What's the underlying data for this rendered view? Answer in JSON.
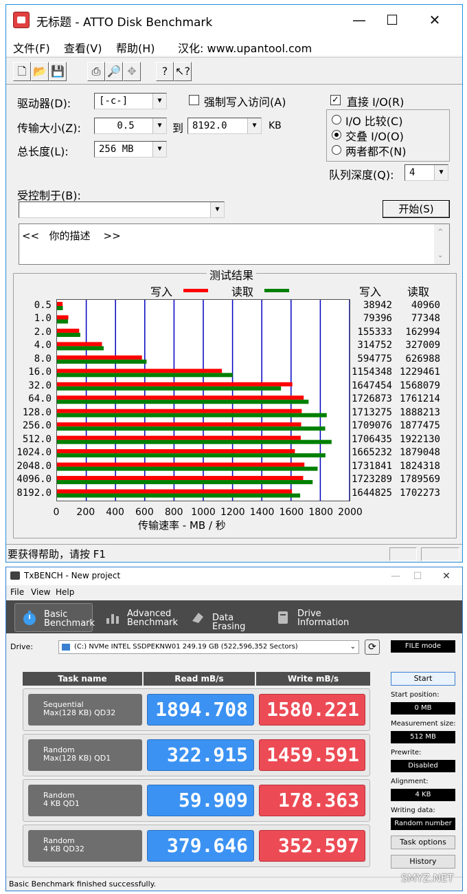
{
  "atto": {
    "title": "无标题 - ATTO Disk Benchmark",
    "menu": [
      "文件(F)",
      "查看(V)",
      "帮助(H)",
      "汉化: www.upantool.com"
    ],
    "toolbar_icons": [
      "new-icon",
      "open-icon",
      "save-icon",
      "print-icon",
      "print-preview-icon",
      "move-icon",
      "help-icon",
      "context-help-icon"
    ],
    "drive_label": "驱动器(D):",
    "drive_value": "[-c-]",
    "force_write_label": "强制写入访问(A)",
    "direct_io_label": "直接 I/O(R)",
    "transfer_size_label": "传输大小(Z):",
    "transfer_from": "0.5",
    "to_label": "到",
    "transfer_to": "8192.0",
    "kb_label": "KB",
    "total_length_label": "总长度(L):",
    "total_length_value": "256 MB",
    "io_compare_label": "I/O 比较(C)",
    "overlap_io_label": "交叠 I/O(O)",
    "neither_label": "两者都不(N)",
    "queue_depth_label": "队列深度(Q):",
    "queue_depth_value": "4",
    "controlled_by_label": "受控制于(B):",
    "controlled_by_value": "",
    "start_button": "开始(S)",
    "description": "<<   你的描述    >>",
    "results_title": "测试结果",
    "legend_write": "写入",
    "legend_read": "读取",
    "col_write": "写入",
    "col_read": "读取",
    "xaxis_label": "传输速率 - MB / 秒",
    "status_text": "要获得帮助，请按 F1"
  },
  "chart_data": {
    "type": "bar",
    "orientation": "horizontal",
    "title": "测试结果",
    "xlabel": "传输速率 - MB / 秒",
    "xlim": [
      0,
      2000
    ],
    "xticks": [
      "0",
      "200",
      "400",
      "600",
      "800",
      "1000",
      "1200",
      "1400",
      "1600",
      "1800",
      "2000"
    ],
    "categories": [
      "0.5",
      "1.0",
      "2.0",
      "4.0",
      "8.0",
      "16.0",
      "32.0",
      "64.0",
      "128.0",
      "256.0",
      "512.0",
      "1024.0",
      "2048.0",
      "4096.0",
      "8192.0"
    ],
    "series": [
      {
        "name": "写入",
        "color": "#ff0000",
        "values": [
          38942,
          79396,
          155333,
          314752,
          594775,
          1154348,
          1647454,
          1726873,
          1713275,
          1709076,
          1706435,
          1665232,
          1731841,
          1723289,
          1644825
        ]
      },
      {
        "name": "读取",
        "color": "#008000",
        "values": [
          40960,
          77348,
          162994,
          327009,
          626988,
          1229461,
          1568079,
          1761214,
          1888213,
          1877475,
          1922130,
          1879048,
          1824318,
          1789569,
          1702273
        ]
      }
    ],
    "units_note": "listed values in KB/s; bars plotted against MB/s axis",
    "grid": true
  },
  "txbench": {
    "title": "TxBENCH - New project",
    "menu": [
      "File",
      "View",
      "Help"
    ],
    "tabs": [
      {
        "line1": "Basic",
        "line2": "Benchmark",
        "icon": "stopwatch-icon",
        "active": true
      },
      {
        "line1": "Advanced",
        "line2": "Benchmark",
        "icon": "bar-chart-icon",
        "active": false
      },
      {
        "line1": "Data Erasing",
        "line2": "",
        "icon": "eraser-icon",
        "active": false
      },
      {
        "line1": "Drive",
        "line2": "Information",
        "icon": "drive-info-icon",
        "active": false
      }
    ],
    "drive_label": "Drive:",
    "drive_value": "(C:) NVMe INTEL SSDPEKNW01  249.19 GB (522,596,352 Sectors)",
    "mode_badge": "FILE mode",
    "headers": {
      "task": "Task name",
      "read": "Read mB/s",
      "write": "Write mB/s"
    },
    "rows": [
      {
        "line1": "Sequential",
        "line2": "Max(128 KB) QD32",
        "read": "1894.708",
        "write": "1580.221"
      },
      {
        "line1": "Random",
        "line2": "Max(128 KB) QD1",
        "read": "322.915",
        "write": "1459.591"
      },
      {
        "line1": "Random",
        "line2": "4 KB QD1",
        "read": "59.909",
        "write": "178.363"
      },
      {
        "line1": "Random",
        "line2": "4 KB QD32",
        "read": "379.646",
        "write": "352.597"
      }
    ],
    "start_button": "Start",
    "start_position_label": "Start position:",
    "start_position_value": "0 MB",
    "measurement_size_label": "Measurement size:",
    "measurement_size_value": "512 MB",
    "prewrite_label": "Prewrite:",
    "prewrite_value": "Disabled",
    "alignment_label": "Alignment:",
    "alignment_value": "4 KB",
    "writing_data_label": "Writing data:",
    "writing_data_value": "Random number",
    "task_options_button": "Task options",
    "history_button": "History",
    "status_text": "Basic Benchmark finished successfully."
  },
  "watermark": "SMYZ.NET"
}
